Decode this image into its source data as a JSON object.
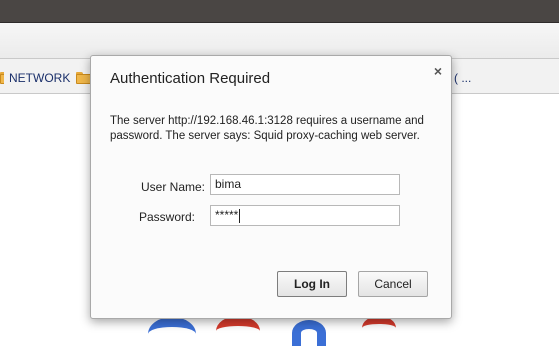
{
  "bookmarks": {
    "items": [
      {
        "label": "NETWORK"
      },
      {
        "label": ""
      },
      {
        "label": "( ..."
      }
    ]
  },
  "dialog": {
    "title": "Authentication Required",
    "close_label": "×",
    "message": "The server http://192.168.46.1:3128 requires a username and password. The server says: Squid proxy-caching web server.",
    "username_label": "User Name:",
    "username_value": "bima",
    "password_label": "Password:",
    "password_value": "*****",
    "login_label": "Log In",
    "cancel_label": "Cancel"
  }
}
